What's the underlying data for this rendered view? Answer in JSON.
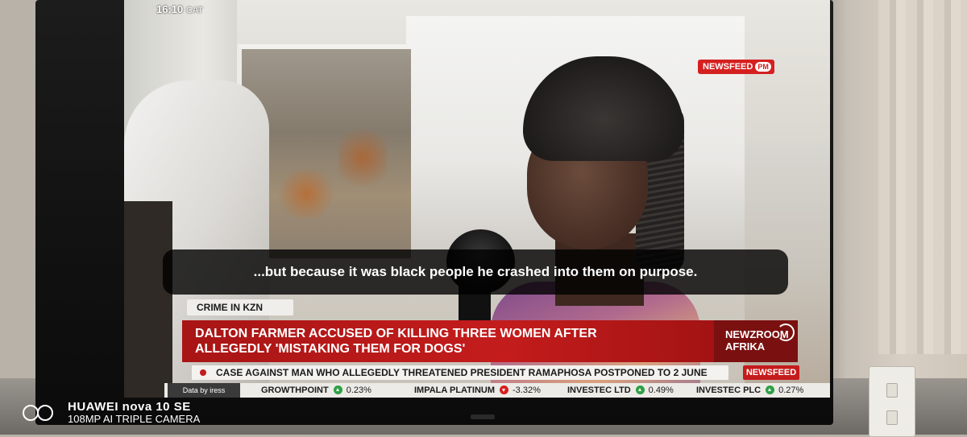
{
  "broadcast": {
    "time": "16:10",
    "timezone": "CAT",
    "program_badge": "NEWSFEED",
    "program_badge_suffix": "PM",
    "subtitle": "...but because it was black people he crashed into them on purpose.",
    "category_tag": "CRIME IN KZN",
    "headline_line1": "DALTON FARMER ACCUSED OF KILLING THREE WOMEN AFTER",
    "headline_line2": "ALLEGEDLY 'MISTAKING THEM FOR DOGS'",
    "logo_line1": "NEWZROOM",
    "logo_line2": "AFRIKA",
    "ticker_text": "CASE AGAINST MAN WHO ALLEGEDLY THREATENED PRESIDENT RAMAPHOSA POSTPONED TO 2 JUNE",
    "ticker_badge": "NEWSFEED",
    "data_source": "Data by iress",
    "stocks": [
      {
        "name": "GROWTHPOINT",
        "direction": "up",
        "change": "0.23%"
      },
      {
        "name": "IMPALA PLATINUM",
        "direction": "down",
        "change": "-3.32%"
      },
      {
        "name": "INVESTEC LTD",
        "direction": "up",
        "change": "0.49%"
      },
      {
        "name": "INVESTEC PLC",
        "direction": "up",
        "change": "0.27%"
      }
    ],
    "colors": {
      "accent_red": "#c41c1c",
      "up_green": "#2ea043",
      "down_red": "#d52020"
    }
  },
  "camera_watermark": {
    "line1": "HUAWEI nova 10 SE",
    "line2": "108MP AI TRIPLE CAMERA",
    "icon": "dual-ring-logo"
  }
}
